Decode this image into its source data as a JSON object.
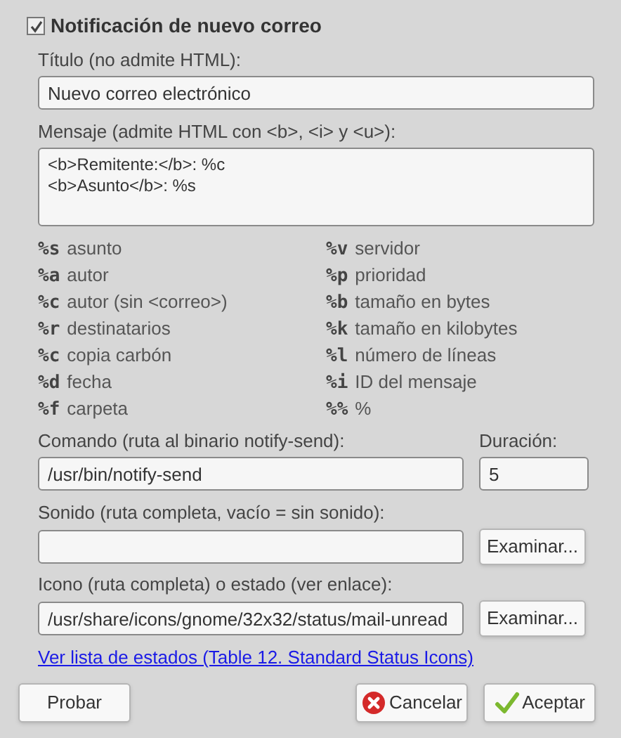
{
  "header": {
    "label": "Notificación de nuevo correo",
    "checked": true
  },
  "title_field": {
    "label": "Título (no admite HTML):",
    "value": "Nuevo correo electrónico"
  },
  "message_field": {
    "label": "Mensaje (admite HTML con <b>, <i> y <u>):",
    "lines": [
      "<b>Remitente:</b>: %c",
      "<b>Asunto</b>: %s"
    ]
  },
  "placeholders": [
    {
      "code": "%s",
      "description": "asunto"
    },
    {
      "code": "%v",
      "description": "servidor"
    },
    {
      "code": "%a",
      "description": "autor"
    },
    {
      "code": "%p",
      "description": "prioridad"
    },
    {
      "code": "%c",
      "description": "autor (sin <correo>)"
    },
    {
      "code": "%b",
      "description": "tamaño en bytes"
    },
    {
      "code": "%r",
      "description": "destinatarios"
    },
    {
      "code": "%k",
      "description": "tamaño en kilobytes"
    },
    {
      "code": "%c",
      "description": "copia carbón"
    },
    {
      "code": "%l",
      "description": "número de líneas"
    },
    {
      "code": "%d",
      "description": "fecha"
    },
    {
      "code": "%i",
      "description": "ID del mensaje"
    },
    {
      "code": "%f",
      "description": "carpeta"
    },
    {
      "code": "%%",
      "description": "%"
    }
  ],
  "command_field": {
    "label": "Comando (ruta al binario notify-send):",
    "value": "/usr/bin/notify-send"
  },
  "duration_field": {
    "label": "Duración:",
    "value": "5"
  },
  "sound_field": {
    "label": "Sonido (ruta completa, vacío = sin sonido):",
    "browse": "Examinar..."
  },
  "icon_field": {
    "label": "Icono (ruta completa) o estado (ver enlace):",
    "value": "/usr/share/icons/gnome/32x32/status/mail-unread",
    "browse": "Examinar..."
  },
  "status_link": "Ver lista de estados (Table 12. Standard Status Icons)",
  "buttons": [
    {
      "kind": "test",
      "label": "Probar"
    },
    {
      "kind": "cancel",
      "label": "Cancelar"
    },
    {
      "kind": "ok",
      "label": "Aceptar"
    }
  ]
}
